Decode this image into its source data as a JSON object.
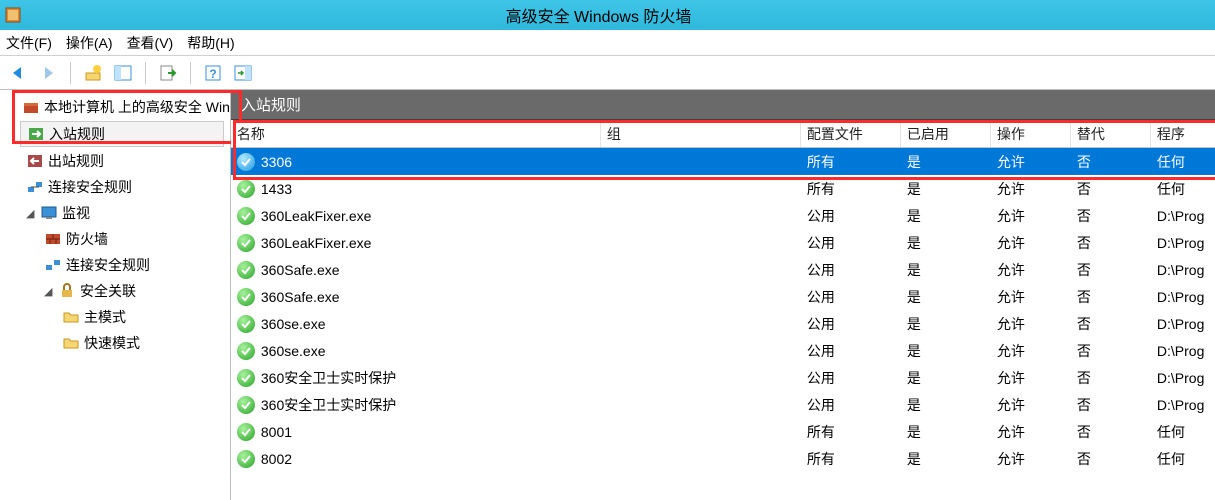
{
  "window": {
    "title": "高级安全 Windows 防火墙"
  },
  "menus": {
    "file": "文件(F)",
    "action": "操作(A)",
    "view": "查看(V)",
    "help": "帮助(H)"
  },
  "tree": {
    "root": "本地计算机 上的高级安全 Win",
    "inbound": "入站规则",
    "outbound": "出站规则",
    "connsec": "连接安全规则",
    "monitor": "监视",
    "mon_fw": "防火墙",
    "mon_connsec": "连接安全规则",
    "mon_sa": "安全关联",
    "mon_main": "主模式",
    "mon_quick": "快速模式"
  },
  "content": {
    "header": "入站规则"
  },
  "columns": {
    "name": "名称",
    "group": "组",
    "profile": "配置文件",
    "enabled": "已启用",
    "action": "操作",
    "override": "替代",
    "program": "程序"
  },
  "rules": [
    {
      "name": "3306",
      "group": "",
      "profile": "所有",
      "enabled": "是",
      "action": "允许",
      "override": "否",
      "program": "任何",
      "selected": true
    },
    {
      "name": "1433",
      "group": "",
      "profile": "所有",
      "enabled": "是",
      "action": "允许",
      "override": "否",
      "program": "任何"
    },
    {
      "name": "360LeakFixer.exe",
      "group": "",
      "profile": "公用",
      "enabled": "是",
      "action": "允许",
      "override": "否",
      "program": "D:\\Prog"
    },
    {
      "name": "360LeakFixer.exe",
      "group": "",
      "profile": "公用",
      "enabled": "是",
      "action": "允许",
      "override": "否",
      "program": "D:\\Prog"
    },
    {
      "name": "360Safe.exe",
      "group": "",
      "profile": "公用",
      "enabled": "是",
      "action": "允许",
      "override": "否",
      "program": "D:\\Prog"
    },
    {
      "name": "360Safe.exe",
      "group": "",
      "profile": "公用",
      "enabled": "是",
      "action": "允许",
      "override": "否",
      "program": "D:\\Prog"
    },
    {
      "name": "360se.exe",
      "group": "",
      "profile": "公用",
      "enabled": "是",
      "action": "允许",
      "override": "否",
      "program": "D:\\Prog"
    },
    {
      "name": "360se.exe",
      "group": "",
      "profile": "公用",
      "enabled": "是",
      "action": "允许",
      "override": "否",
      "program": "D:\\Prog"
    },
    {
      "name": "360安全卫士实时保护",
      "group": "",
      "profile": "公用",
      "enabled": "是",
      "action": "允许",
      "override": "否",
      "program": "D:\\Prog"
    },
    {
      "name": "360安全卫士实时保护",
      "group": "",
      "profile": "公用",
      "enabled": "是",
      "action": "允许",
      "override": "否",
      "program": "D:\\Prog"
    },
    {
      "name": "8001",
      "group": "",
      "profile": "所有",
      "enabled": "是",
      "action": "允许",
      "override": "否",
      "program": "任何"
    },
    {
      "name": "8002",
      "group": "",
      "profile": "所有",
      "enabled": "是",
      "action": "允许",
      "override": "否",
      "program": "任何"
    }
  ]
}
